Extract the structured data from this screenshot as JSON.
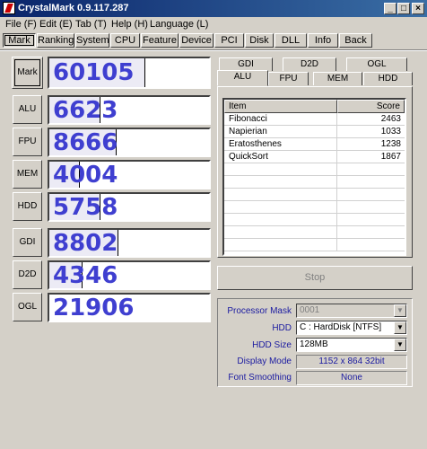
{
  "window": {
    "title": "CrystalMark 0.9.117.287",
    "minimize": "_",
    "maximize": "□",
    "close": "×"
  },
  "menu": [
    "File (F)",
    "Edit (E)",
    "Tab (T)",
    "Help (H)",
    "Language (L)"
  ],
  "nav": [
    "Mark",
    "Ranking",
    "System",
    "CPU",
    "Feature",
    "Device",
    "PCI",
    "Disk",
    "DLL",
    "Info",
    "Back"
  ],
  "marks": [
    {
      "label": "Mark",
      "score": "60105",
      "fill": 0.6
    },
    {
      "label": "ALU",
      "score": "6623",
      "fill": 0.32
    },
    {
      "label": "FPU",
      "score": "8666",
      "fill": 0.42
    },
    {
      "label": "MEM",
      "score": "4004",
      "fill": 0.19
    },
    {
      "label": "HDD",
      "score": "5758",
      "fill": 0.32
    },
    {
      "label": "GDI",
      "score": "8802",
      "fill": 0.43
    },
    {
      "label": "D2D",
      "score": "4346",
      "fill": 0.21
    },
    {
      "label": "OGL",
      "score": "21906",
      "fill": 0.0
    }
  ],
  "tabs_top": [
    "GDI",
    "D2D",
    "OGL"
  ],
  "tabs_bottom": [
    "ALU",
    "FPU",
    "MEM",
    "HDD"
  ],
  "list": {
    "headers": [
      "Item",
      "Score"
    ],
    "rows": [
      {
        "item": "Fibonacci",
        "score": "2463"
      },
      {
        "item": "Napierian",
        "score": "1033"
      },
      {
        "item": "Eratosthenes",
        "score": "1238"
      },
      {
        "item": "QuickSort",
        "score": "1867"
      }
    ]
  },
  "stop_label": "Stop",
  "info": {
    "processor_mask_label": "Processor Mask",
    "processor_mask_value": "0001",
    "hdd_label": "HDD",
    "hdd_value": "C : HardDisk [NTFS]",
    "hdd_size_label": "HDD Size",
    "hdd_size_value": "128MB",
    "display_mode_label": "Display Mode",
    "display_mode_value": "1152 x 864 32bit",
    "font_smoothing_label": "Font Smoothing",
    "font_smoothing_value": "None"
  }
}
